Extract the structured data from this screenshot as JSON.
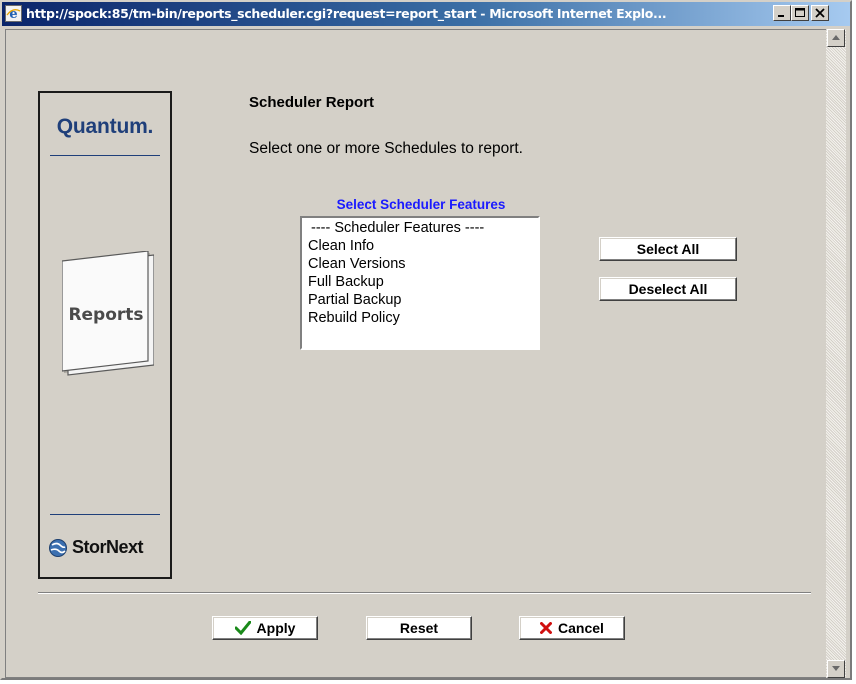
{
  "window": {
    "title": "http://spock:85/tm-bin/reports_scheduler.cgi?request=report_start - Microsoft Internet Explo...",
    "minimize_label": "minimize",
    "maximize_label": "maximize",
    "close_label": "close"
  },
  "brand": {
    "quantum_logo": "Quantum.",
    "reports_label": "Reports",
    "stornext_label": "StorNext"
  },
  "page": {
    "title": "Scheduler Report",
    "description": "Select one or more Schedules to report."
  },
  "features": {
    "label": "Select Scheduler Features",
    "options": [
      "---- Scheduler Features ----",
      "Clean Info",
      "Clean Versions",
      "Full Backup",
      "Partial Backup",
      "Rebuild Policy"
    ]
  },
  "buttons": {
    "select_all": "Select All",
    "deselect_all": "Deselect All",
    "apply": "Apply",
    "reset": "Reset",
    "cancel": "Cancel"
  },
  "colors": {
    "titlebar_start": "#0a246a",
    "window_face": "#d4d0c8",
    "quantum_blue": "#1f3f7a",
    "features_label": "#1a1aff",
    "apply_check": "#1a8a1a",
    "cancel_x": "#d01010"
  },
  "icons": {
    "app": "internet-explorer-icon",
    "apply": "check-icon",
    "cancel": "x-icon",
    "stornext": "globe-icon"
  }
}
